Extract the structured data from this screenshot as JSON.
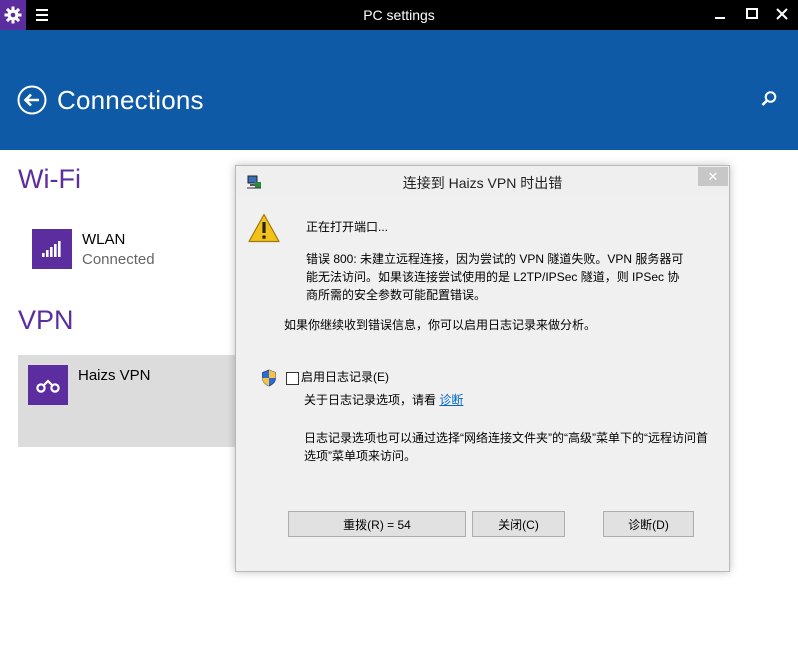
{
  "window": {
    "title": "PC settings"
  },
  "header": {
    "title": "Connections"
  },
  "wifi": {
    "section_title": "Wi-Fi",
    "network": {
      "name": "WLAN",
      "status": "Connected"
    }
  },
  "vpn": {
    "section_title": "VPN",
    "connection": {
      "name": "Haizs VPN"
    }
  },
  "dialog": {
    "title": "连接到 Haizs VPN 时出错",
    "status_text": "正在打开端口...",
    "error_text": "错误 800: 未建立远程连接，因为尝试的 VPN 隧道失败。VPN 服务器可能无法访问。如果该连接尝试使用的是 L2TP/IPSec 隧道，则 IPSec 协商所需的安全参数可能配置错误。",
    "hint_text": "如果你继续收到错误信息，你可以启用日志记录来做分析。",
    "logging_checkbox_label": "启用日志记录(E)",
    "logging_checked": false,
    "about_text": "关于日志记录选项，请看",
    "diagnose_link": "诊断",
    "note_text": "日志记录选项也可以通过选择“网络连接文件夹”的“高级”菜单下的“远程访问首选项”菜单项来访问。",
    "buttons": {
      "redial": "重拨(R) = 54",
      "close": "关闭(C)",
      "diagnose": "诊断(D)"
    },
    "close_glyph": "✕"
  },
  "colors": {
    "accent_purple": "#5b2d9e",
    "header_blue": "#0e5aa7",
    "link_blue": "#0066cc"
  },
  "icons": [
    "settings-gear-icon",
    "hamburger-menu-icon",
    "minimize-icon",
    "maximize-icon",
    "close-icon",
    "back-arrow-icon",
    "search-icon",
    "wifi-signal-icon",
    "vpn-link-icon",
    "network-computer-icon",
    "warning-icon",
    "uac-shield-icon"
  ]
}
